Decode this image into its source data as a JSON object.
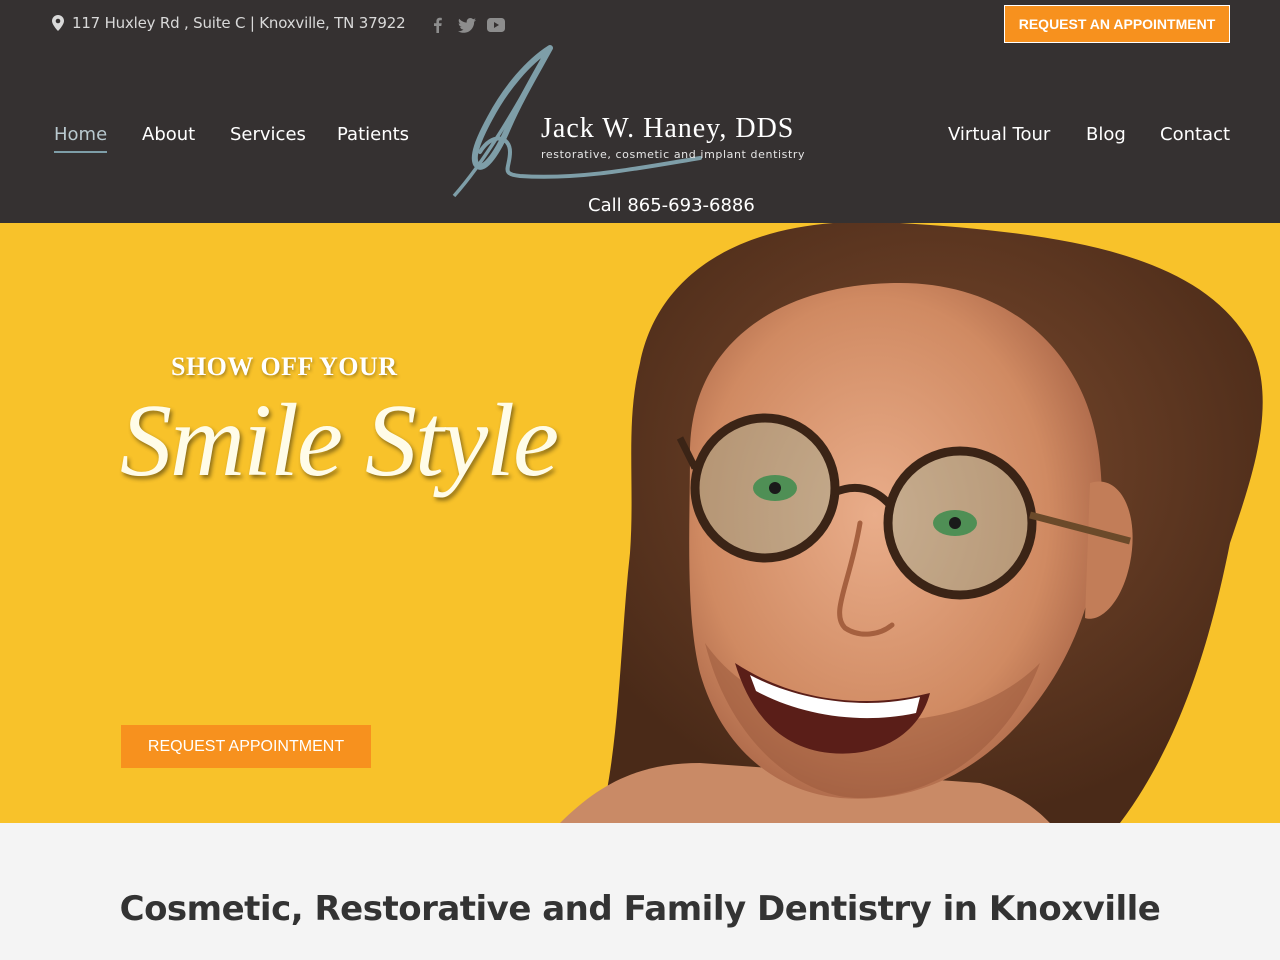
{
  "topbar": {
    "address": "117 Huxley Rd , Suite C | Knoxville, TN 37922",
    "address_icon": "map-pin-icon",
    "social_icons": [
      "facebook-icon",
      "twitter-icon",
      "youtube-icon"
    ],
    "appointment_button": "REQUEST AN APPOINTMENT"
  },
  "nav": {
    "left": [
      "Home",
      "About",
      "Services",
      "Patients"
    ],
    "right": [
      "Virtual Tour",
      "Blog",
      "Contact"
    ],
    "active": "Home"
  },
  "logo": {
    "name": "Jack W. Haney, DDS",
    "tagline": "restorative, cosmetic and implant dentistry"
  },
  "call": "Call 865-693-6886",
  "hero": {
    "kicker": "SHOW OFF YOUR",
    "script": "Smile Style",
    "button": "REQUEST APPOINTMENT"
  },
  "intro": {
    "heading": "Cosmetic, Restorative and Family Dentistry in Knoxville"
  },
  "colors": {
    "header_bg": "#353131",
    "accent_orange": "#f7911e",
    "hero_yellow": "#f8c22a",
    "logo_blue_grey": "#7e9ea8",
    "section_bg": "#f4f4f4"
  }
}
